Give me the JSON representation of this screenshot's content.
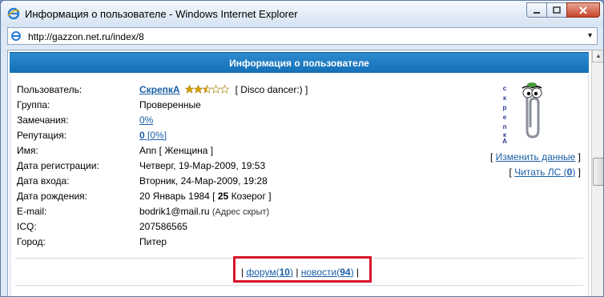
{
  "window": {
    "title": "Информация о пользователе - Windows Internet Explorer",
    "address": "http://gazzon.net.ru/index/8"
  },
  "page": {
    "header": "Информация о пользователе",
    "rows": {
      "user": {
        "label": "Пользователь:",
        "name": "СкрепкА",
        "status": "[ Disco dancer:) ]"
      },
      "group": {
        "label": "Группа:",
        "value": "Проверенные"
      },
      "warnings": {
        "label": "Замечания:",
        "value": "0%"
      },
      "reputation": {
        "label": "Репутация:",
        "value": "0",
        "percent": "[0%]"
      },
      "name": {
        "label": "Имя:",
        "value": "Ann [ Женщина ]"
      },
      "registered": {
        "label": "Дата регистрации:",
        "value": "Четверг, 19-Мар-2009, 19:53"
      },
      "last_login": {
        "label": "Дата входа:",
        "value": "Вторник, 24-Мар-2009, 19:28"
      },
      "birthday": {
        "label": "Дата рождения:",
        "value": "20 Январь 1984 [",
        "age": "25",
        "sign": "Козерог ]"
      },
      "email": {
        "label": "E-mail:",
        "value": "bodrik1@mail.ru",
        "note": "(Адрес скрыт)"
      },
      "icq": {
        "label": "ICQ:",
        "value": "207586565"
      },
      "city": {
        "label": "Город:",
        "value": "Питер"
      }
    },
    "avatar_text": "скрепкА",
    "rating_stars": 2.5,
    "side_links": {
      "edit": "Изменить данные",
      "read_pm": "Читать ЛС",
      "pm_count": "0"
    },
    "bottom_links": {
      "forum": "форум",
      "forum_count": "10",
      "news": "новости",
      "news_count": "94"
    }
  },
  "colors": {
    "header_bg": "#1976be",
    "link": "#1a5fa8",
    "highlight": "#d8152a"
  }
}
